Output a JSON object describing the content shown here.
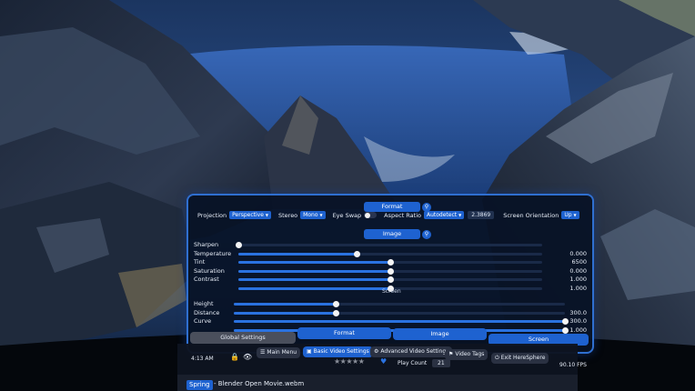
{
  "format": {
    "section_label": "Format",
    "projection_label": "Projection",
    "projection_value": "Perspective",
    "stereo_label": "Stereo",
    "stereo_value": "Mono",
    "eye_swap_label": "Eye Swap",
    "aspect_ratio_label": "Aspect Ratio",
    "aspect_ratio_value": "Autodetect",
    "aspect_ratio_number": "2.3869",
    "screen_orientation_label": "Screen Orientation",
    "screen_orientation_value": "Up"
  },
  "image": {
    "section_label": "Image",
    "sliders": [
      {
        "label": "Sharpen",
        "value": "",
        "fraction": 0.0
      },
      {
        "label": "Temperature",
        "value": "0.000",
        "fraction": 0.39
      },
      {
        "label": "Tint",
        "value": "6500",
        "fraction": 0.5
      },
      {
        "label": "Saturation",
        "value": "0.000",
        "fraction": 0.5
      },
      {
        "label": "Contrast",
        "value": "1.000",
        "fraction": 0.5
      },
      {
        "label": "",
        "value": "1.000",
        "fraction": 0.5
      }
    ]
  },
  "screen": {
    "section_label": "Screen",
    "sliders": [
      {
        "label": "Height",
        "value": "",
        "fraction": 0.31
      },
      {
        "label": "Distance",
        "value": "300.0",
        "fraction": 0.31
      },
      {
        "label": "Curve",
        "value": "300.0",
        "fraction": 1.0
      },
      {
        "label": "",
        "value": "1.000",
        "fraction": 1.0
      }
    ]
  },
  "tabs": {
    "global": "Global Settings",
    "format": "Format",
    "image": "Image",
    "screen": "Screen"
  },
  "bottom": {
    "time": "4:13 AM",
    "main_menu": "Main Menu",
    "basic_video": "Basic Video Settings",
    "advanced_video": "Advanced Video Settings",
    "video_tags": "Video Tags",
    "exit": "Exit HereSphere",
    "stars": "★★★★★",
    "play_count_label": "Play Count",
    "play_count_value": "21",
    "fps": "90.10 FPS",
    "spring_tag": "Spring",
    "filename": "- Blender Open Movie.webm"
  },
  "colors": {
    "accent": "#1e62d0",
    "panel_border": "#2f6fd0",
    "panel_bg": "#08122e"
  }
}
